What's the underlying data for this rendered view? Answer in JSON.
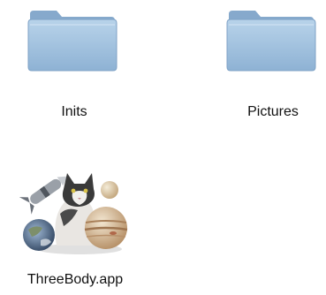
{
  "items": [
    {
      "name": "Inits",
      "kind": "folder"
    },
    {
      "name": "Pictures",
      "kind": "folder"
    },
    {
      "name": "ThreeBody.app",
      "kind": "application"
    }
  ],
  "colors": {
    "folder_front": "#a9c6e0",
    "folder_back": "#8fb1d2",
    "label_text": "#111111"
  }
}
